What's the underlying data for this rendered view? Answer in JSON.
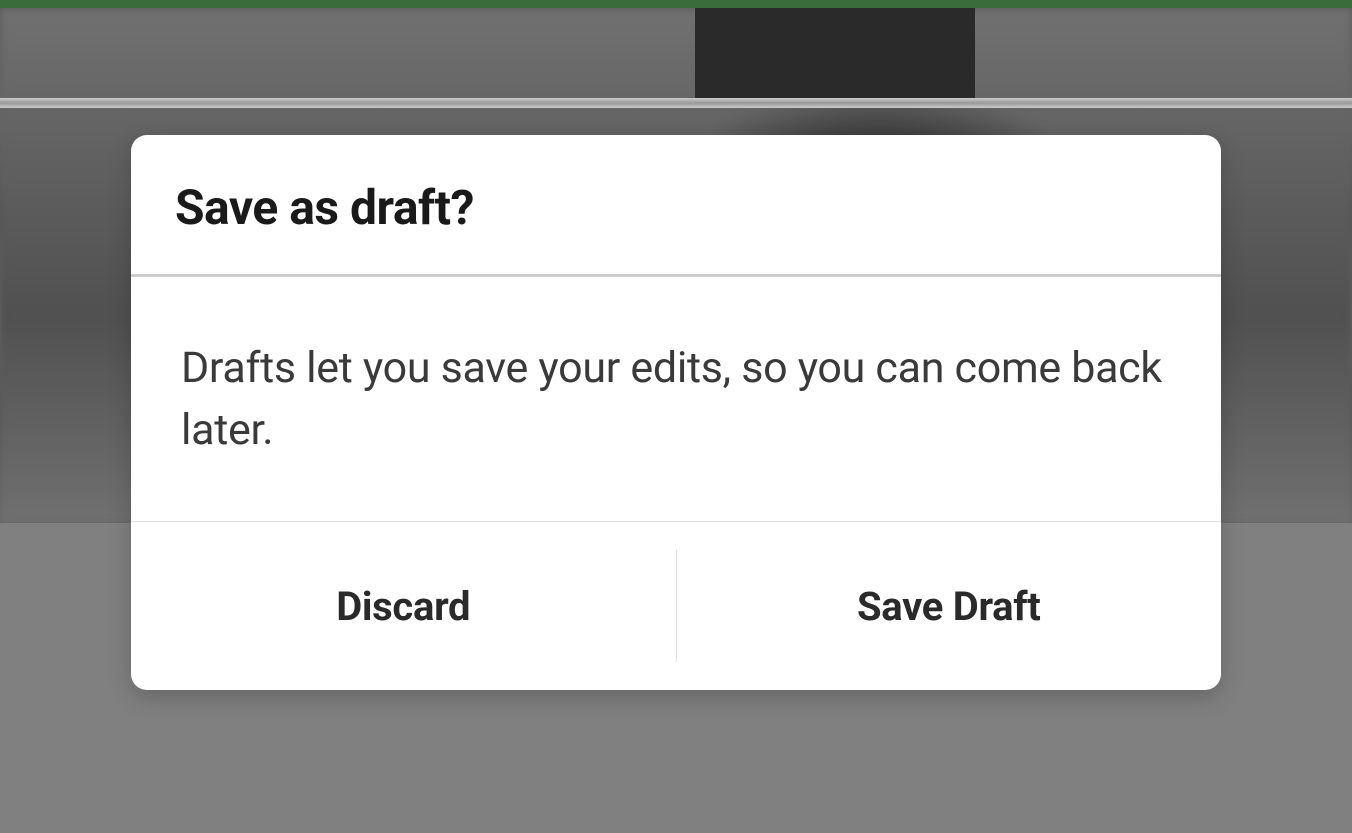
{
  "dialog": {
    "title": "Save as draft?",
    "message": "Drafts let you save your edits, so you can come back later.",
    "discard_label": "Discard",
    "save_label": "Save Draft"
  }
}
